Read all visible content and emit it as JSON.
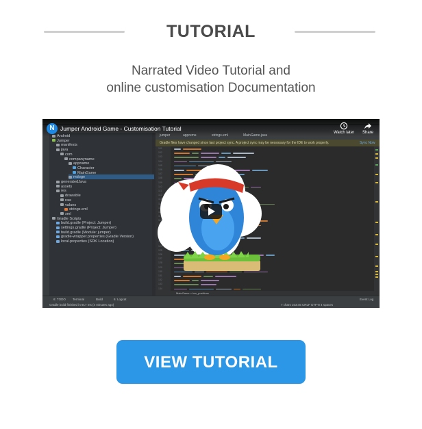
{
  "header": {
    "title": "TUTORIAL"
  },
  "intro": {
    "line1": "Narrated Video Tutorial and",
    "line2": "online customisation Documentation"
  },
  "video": {
    "title": "Jumper Android Game - Customisation Tutorial",
    "channel_badge": "N",
    "watch_later_label": "Watch later",
    "share_label": "Share",
    "ide": {
      "notice_text": "Gradle files have changed since last project sync. A project sync may be necessary for the IDE to work properly.",
      "notice_action": "Sync Now",
      "tabs": [
        "jumper",
        "apprems",
        "strings.xml",
        "MainGame.java"
      ],
      "tree": [
        {
          "label": "Android",
          "indent": 0,
          "icon": "#9aa0a6"
        },
        {
          "label": "Jumper",
          "indent": 0,
          "icon": "#8bc34a"
        },
        {
          "label": "manifests",
          "indent": 1,
          "icon": "#9aa0a6"
        },
        {
          "label": "java",
          "indent": 1,
          "icon": "#9aa0a6"
        },
        {
          "label": "com",
          "indent": 2,
          "icon": "#9aa0a6"
        },
        {
          "label": "companyname",
          "indent": 3,
          "icon": "#9aa0a6"
        },
        {
          "label": "appname",
          "indent": 4,
          "icon": "#9aa0a6"
        },
        {
          "label": "Character",
          "indent": 5,
          "icon": "#4fa3e0"
        },
        {
          "label": "MainGame",
          "indent": 5,
          "icon": "#4fa3e0"
        },
        {
          "label": "mdoge",
          "indent": 4,
          "icon": "#9aa0a6"
        },
        {
          "label": "generatedJava",
          "indent": 1,
          "icon": "#9aa0a6"
        },
        {
          "label": "assets",
          "indent": 1,
          "icon": "#9aa0a6"
        },
        {
          "label": "res",
          "indent": 1,
          "icon": "#9aa0a6"
        },
        {
          "label": "drawable",
          "indent": 2,
          "icon": "#9aa0a6"
        },
        {
          "label": "raw",
          "indent": 2,
          "icon": "#9aa0a6"
        },
        {
          "label": "values",
          "indent": 2,
          "icon": "#9aa0a6"
        },
        {
          "label": "strings.xml",
          "indent": 3,
          "icon": "#e07b39"
        },
        {
          "label": "xml",
          "indent": 2,
          "icon": "#9aa0a6"
        },
        {
          "label": "Gradle Scripts",
          "indent": 0,
          "icon": "#9aa0a6"
        },
        {
          "label": "build.gradle (Project: Jumper)",
          "indent": 1,
          "icon": "#6ea8e0"
        },
        {
          "label": "settings.gradle (Project: Jumper)",
          "indent": 1,
          "icon": "#6ea8e0"
        },
        {
          "label": "build.gradle (Module: jumper)",
          "indent": 1,
          "icon": "#6ea8e0"
        },
        {
          "label": "gradle-wrapper.properties (Gradle Version)",
          "indent": 1,
          "icon": "#6ea8e0"
        },
        {
          "label": "local.properties (SDK Location)",
          "indent": 1,
          "icon": "#6ea8e0"
        }
      ],
      "breadcrumb": "MainGame  >  bar_positions",
      "status_tabs": [
        "6: TODO",
        "Terminal",
        "Build",
        "6: Logcat"
      ],
      "status_message": "Gradle build finished in 917 ms (4 minutes ago)",
      "status_right": "7 chars   103:45   CRLF   UTF-8   4 spaces",
      "event_log": "Event Log"
    },
    "colors": {
      "ide_bg": "#2b2d30",
      "bird": "#2f86d9",
      "headband": "#d83a2a",
      "grass": "#6cbf3a"
    }
  },
  "cta": {
    "label": "VIEW TUTORIAL",
    "color": "#2d97e7"
  }
}
